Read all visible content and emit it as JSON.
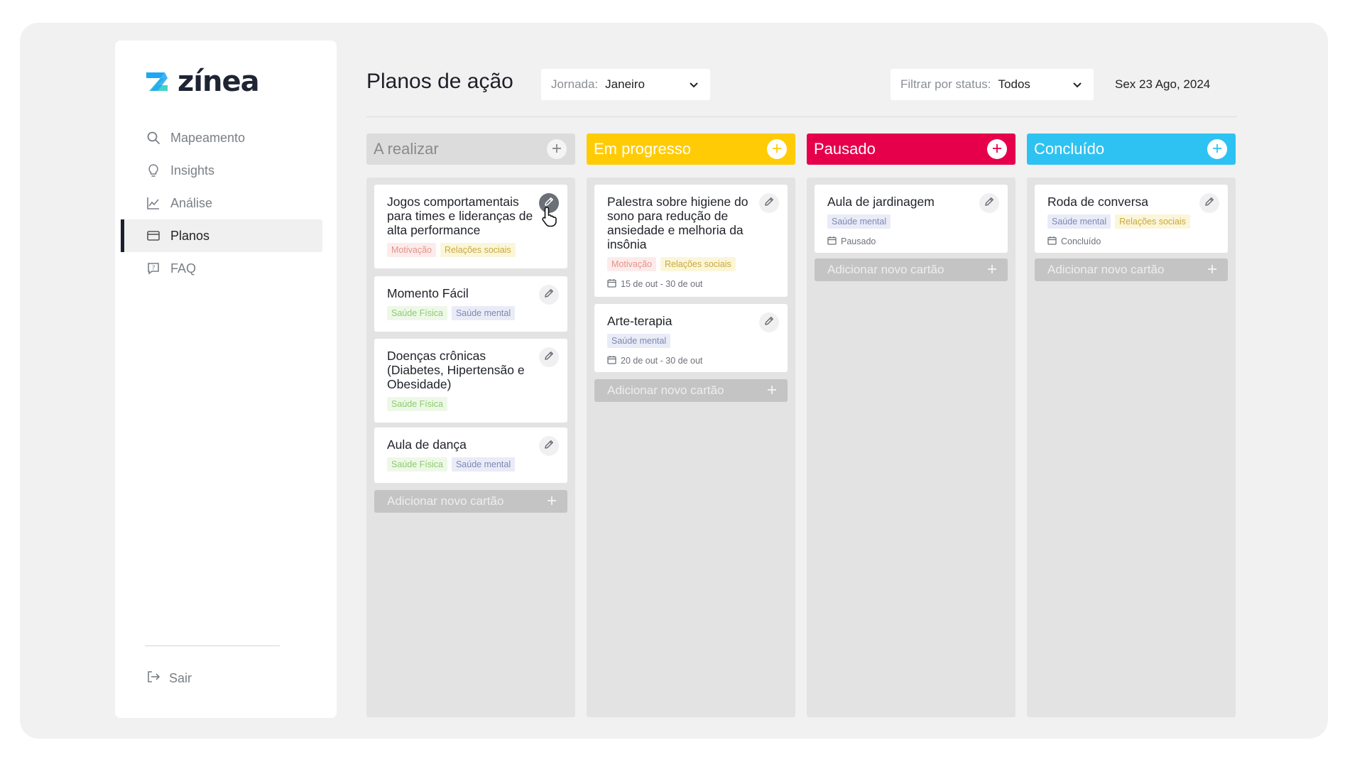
{
  "brand": {
    "name": "zínea",
    "mark_colors": [
      "#1ea7f5",
      "#43d3c8"
    ]
  },
  "sidebar": {
    "items": [
      {
        "label": "Mapeamento",
        "icon": "search-icon",
        "active": false
      },
      {
        "label": "Insights",
        "icon": "lightbulb-icon",
        "active": false
      },
      {
        "label": "Análise",
        "icon": "line-chart-icon",
        "active": false
      },
      {
        "label": "Planos",
        "icon": "window-icon",
        "active": true
      },
      {
        "label": "FAQ",
        "icon": "question-chat-icon",
        "active": false
      }
    ],
    "logout": {
      "label": "Sair",
      "icon": "logout-icon"
    }
  },
  "header": {
    "title": "Planos de ação",
    "journey_select": {
      "label": "Jornada:",
      "value": "Janeiro"
    },
    "status_select": {
      "label": "Filtrar por status:",
      "value": "Todos"
    },
    "date": "Sex 23 Ago, 2024"
  },
  "add_card_label": "Adicionar novo cartão",
  "columns": [
    {
      "title": "A realizar",
      "color": "#dcdcdc",
      "text_color": "#8a8a8a",
      "cards": [
        {
          "title": "Jogos comportamentais para times e lideranças de alta performance",
          "tags": [
            {
              "label": "Motivação",
              "kind": "mot"
            },
            {
              "label": "Relações sociais",
              "kind": "rel"
            }
          ]
        },
        {
          "title": "Momento Fácil",
          "tags": [
            {
              "label": "Saúde Física",
              "kind": "fis"
            },
            {
              "label": "Saúde mental",
              "kind": "men"
            }
          ]
        },
        {
          "title": "Doenças crônicas (Diabetes, Hipertensão e Obesidade)",
          "tags": [
            {
              "label": "Saúde Física",
              "kind": "fis"
            }
          ]
        },
        {
          "title": "Aula de dança",
          "tags": [
            {
              "label": "Saúde Física",
              "kind": "fis"
            },
            {
              "label": "Saúde mental",
              "kind": "men"
            }
          ]
        }
      ]
    },
    {
      "title": "Em progresso",
      "color": "#ffcb05",
      "text_color": "#ffffff",
      "cards": [
        {
          "title": "Palestra sobre higiene do sono para redução de ansiedade e melhoria da insônia",
          "tags": [
            {
              "label": "Motivação",
              "kind": "mot"
            },
            {
              "label": "Relações sociais",
              "kind": "rel"
            }
          ],
          "meta": "15 de out - 30 de out"
        },
        {
          "title": "Arte-terapia",
          "tags": [
            {
              "label": "Saúde mental",
              "kind": "men"
            }
          ],
          "meta": "20 de out - 30 de out"
        }
      ]
    },
    {
      "title": "Pausado",
      "color": "#e6004c",
      "text_color": "#ffffff",
      "cards": [
        {
          "title": "Aula de jardinagem",
          "tags": [
            {
              "label": "Saúde mental",
              "kind": "men"
            }
          ],
          "meta": "Pausado"
        }
      ]
    },
    {
      "title": "Concluído",
      "color": "#2ec2f2",
      "text_color": "#ffffff",
      "cards": [
        {
          "title": "Roda de conversa",
          "tags": [
            {
              "label": "Saúde mental",
              "kind": "men"
            },
            {
              "label": "Relações sociais",
              "kind": "rel"
            }
          ],
          "meta": "Concluído"
        }
      ]
    }
  ]
}
